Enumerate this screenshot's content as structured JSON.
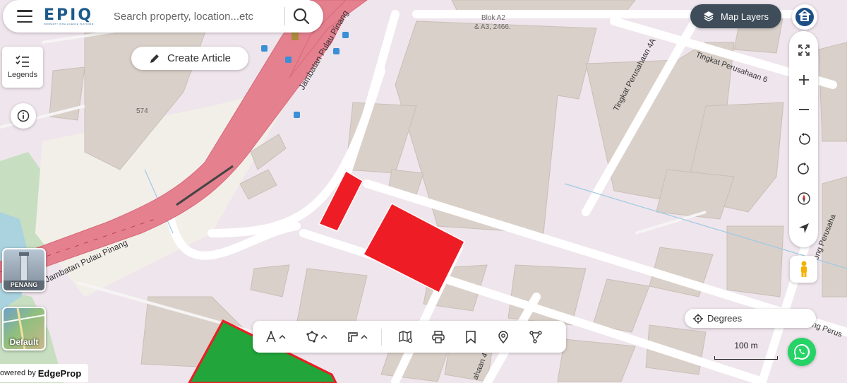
{
  "header": {
    "logo_text": "EPIQ",
    "logo_subtext": "PROPERTY INTELLIGENCE PLATFORM",
    "search_placeholder": "Search property, location...etc"
  },
  "create_article_label": "Create Article",
  "legends_label": "Legends",
  "map_layers_label": "Map Layers",
  "degrees_label": "Degrees",
  "scale_label": "100 m",
  "thumbnails": [
    {
      "label": "PENANG"
    },
    {
      "label": "Default"
    }
  ],
  "powered_by": {
    "prefix": "owered by",
    "brand": "EdgeProp"
  },
  "map_labels": {
    "bridge_upper": "Jambatan Pulau Pinang",
    "bridge_lower": "Jambatan Pulau Pinang",
    "street_4a": "Tingkat Perusahaan 4A",
    "street_6": "Tingkat Perusahaan 6",
    "street_lower": "ahaan 4",
    "street_right": "rong Perusaha",
    "street_right2": "ng Perus",
    "block": "Blok A2",
    "block_num": "& A3, 2466.",
    "lot": "574"
  },
  "colors": {
    "highlight_red": "#ee1c24",
    "highlight_green": "#22a53a",
    "highway": "#e5808f",
    "map_layers_bg": "#3f4d5a",
    "brand_blue": "#1c5a8a"
  },
  "icons": {
    "menu": "hamburger-icon",
    "search": "search-icon",
    "pencil": "pencil-icon",
    "legends": "list-icon",
    "info": "info-icon",
    "layers": "layers-icon",
    "user": "user-account-icon",
    "fullscreen": "expand-icon",
    "zoom_in": "plus-icon",
    "zoom_out": "minus-icon",
    "rotate_left": "rotate-left-icon",
    "rotate_right": "rotate-right-icon",
    "compass": "compass-icon",
    "locate": "navigate-icon",
    "streetview": "pegman-icon",
    "whatsapp": "whatsapp-icon"
  }
}
